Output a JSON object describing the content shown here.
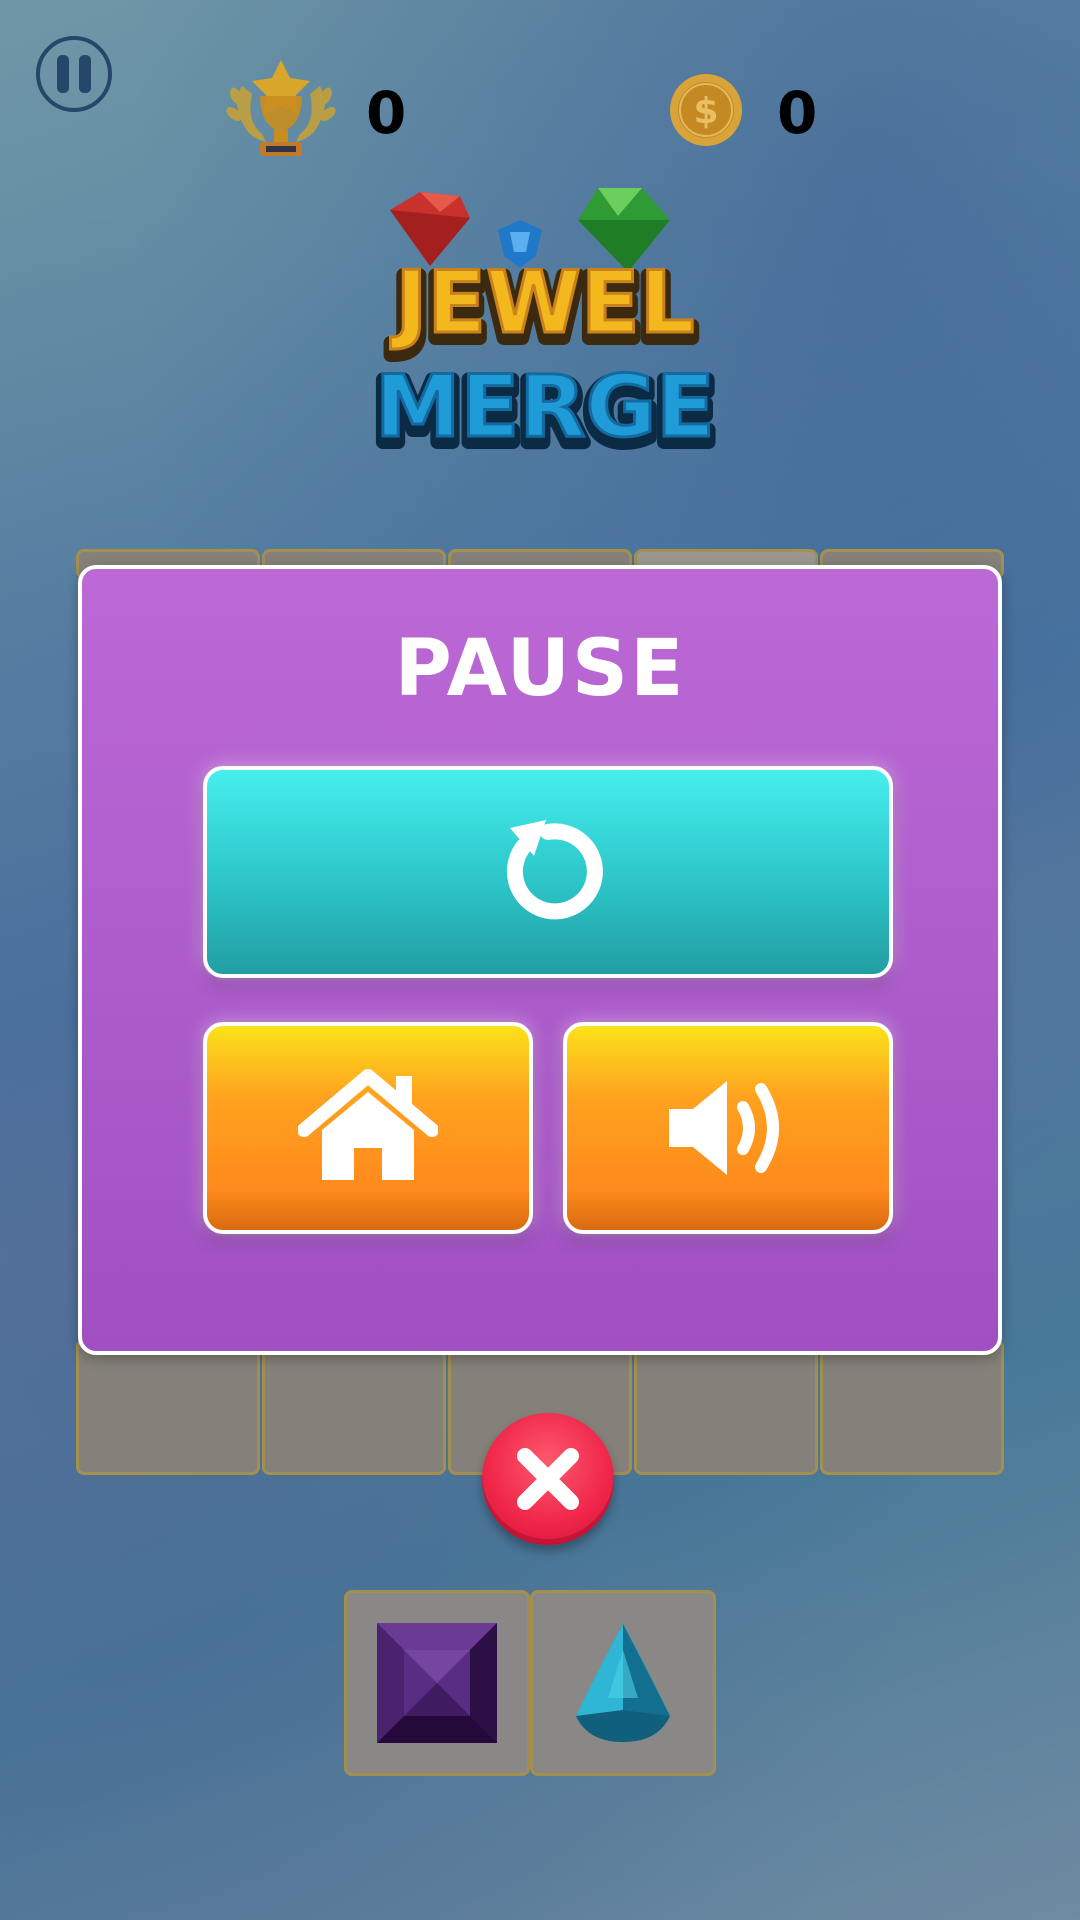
{
  "hud": {
    "trophy_icon": "trophy-icon",
    "trophy_count": "0",
    "coin_icon": "coin-icon",
    "coin_count": "0",
    "pause_icon": "pause-icon"
  },
  "logo": {
    "line1": "JEWEL",
    "line2": "MERGE"
  },
  "pause_panel": {
    "title": "PAUSE",
    "restart_icon": "restart-icon",
    "home_icon": "home-icon",
    "sound_icon": "sound-on-icon",
    "close_icon": "close-icon"
  },
  "tray": {
    "items": [
      {
        "name": "purple-square-gem",
        "color": "#5b2a86"
      },
      {
        "name": "teal-teardrop-gem",
        "color": "#1f9bb8"
      }
    ]
  },
  "colors": {
    "panel": "#b45fd0",
    "restart": "#35d6d9",
    "home_sound": "#ff951e",
    "close": "#ef2449"
  }
}
